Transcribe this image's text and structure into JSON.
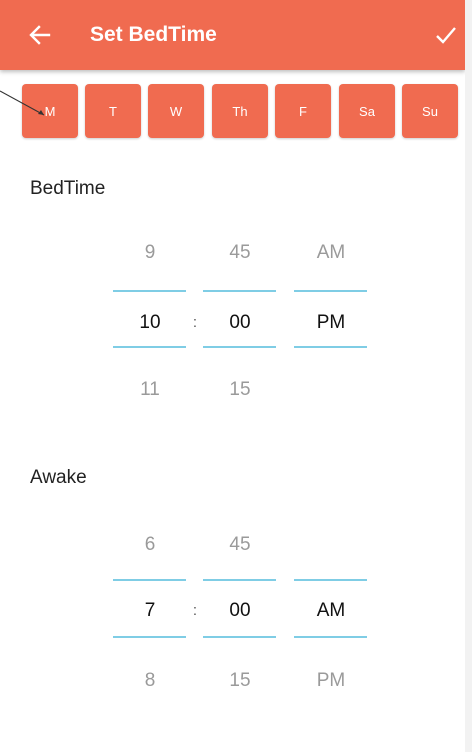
{
  "header": {
    "title": "Set BedTime",
    "back_icon": "arrow-left-icon",
    "confirm_icon": "check-icon",
    "color": "#f06b50"
  },
  "days": [
    "M",
    "T",
    "W",
    "Th",
    "F",
    "Sa",
    "Su"
  ],
  "bedtime": {
    "label": "BedTime",
    "hour": {
      "prev": "9",
      "value": "10",
      "next": "11"
    },
    "separator": ":",
    "minute": {
      "prev": "45",
      "value": "00",
      "next": "15"
    },
    "ampm": {
      "prev": "AM",
      "value": "PM",
      "next": ""
    }
  },
  "awake": {
    "label": "Awake",
    "hour": {
      "prev": "6",
      "value": "7",
      "next": "8"
    },
    "separator": ":",
    "minute": {
      "prev": "45",
      "value": "00",
      "next": "15"
    },
    "ampm": {
      "prev": "",
      "value": "AM",
      "next": "PM"
    }
  },
  "colors": {
    "accent": "#f06b50",
    "divider": "#7fcde5"
  }
}
